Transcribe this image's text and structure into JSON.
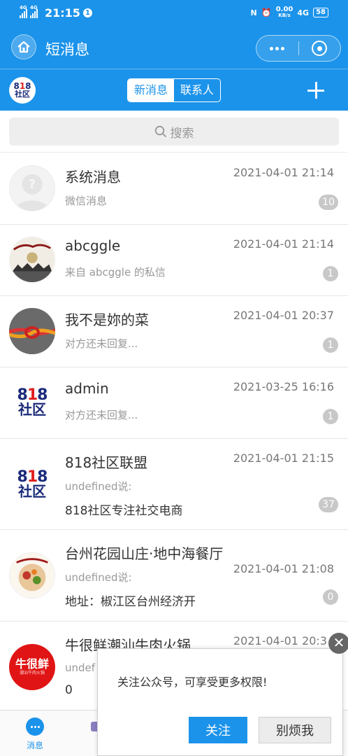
{
  "statusbar": {
    "network1": "4G",
    "network2": "4G",
    "time": "21:15",
    "speed_value": "0.00",
    "speed_unit": "KB/s",
    "network3": "4G",
    "battery": "58",
    "nfc_glyph": "N",
    "alarm_glyph": "⏰"
  },
  "header": {
    "title": "短消息",
    "home_icon": "home-icon",
    "more_icon": "more-dots-icon",
    "close_icon": "target-close-icon"
  },
  "tabs": {
    "logo_line1_a": "8",
    "logo_line1_b": "1",
    "logo_line1_c": "8",
    "logo_line2": "社区",
    "new_messages": "新消息",
    "contacts": "联系人",
    "add_icon": "plus-icon"
  },
  "search": {
    "placeholder": "搜索",
    "icon": "search-icon"
  },
  "conversations": [
    {
      "name": "系统消息",
      "time": "2021-04-01 21:14",
      "preview": "微信消息",
      "count": "10",
      "avatar": "default-user-avatar"
    },
    {
      "name": "abcggle",
      "time": "2021-04-01 21:14",
      "preview": "来自 abcggle 的私信",
      "count": "1",
      "avatar": "horses-avatar"
    },
    {
      "name": "我不是妳的菜",
      "time": "2021-04-01 20:37",
      "preview": "对方还未回复...",
      "count": "1",
      "avatar": "knot-avatar"
    },
    {
      "name": "admin",
      "time": "2021-03-25 16:16",
      "preview": "对方还未回复...",
      "count": "1",
      "avatar": "818-logo-avatar"
    },
    {
      "name": "818社区联盟",
      "time": "2021-04-01 21:15",
      "preview": "undefined说:",
      "preview2": "818社区专注社交电商",
      "count": "37",
      "avatar": "818-logo-avatar"
    },
    {
      "name": "台州花园山庄·地中海餐厅",
      "time": "2021-04-01 21:08",
      "preview": "undefined说:",
      "preview2": "地址：椒江区台州经济开",
      "count": "0",
      "avatar": "restaurant-avatar"
    },
    {
      "name": "牛很鲜潮汕牛肉火锅",
      "time": "2021-04-01 20:3",
      "preview": "undef",
      "preview2": "0",
      "avatar": "hotpot-logo-avatar",
      "avatar_text": "牛很鲜",
      "avatar_subtext": "潮汕牛肉火锅"
    }
  ],
  "bottom_nav": {
    "messages_label": "消息"
  },
  "popup": {
    "message": "关注公众号，可享受更多权限!",
    "follow_label": "关注",
    "dismiss_label": "别烦我",
    "close_glyph": "✕"
  },
  "colors": {
    "primary": "#1b93ea",
    "badge": "#c8c8c8",
    "logo_red": "#e02020",
    "logo_navy": "#1a2a7a"
  }
}
